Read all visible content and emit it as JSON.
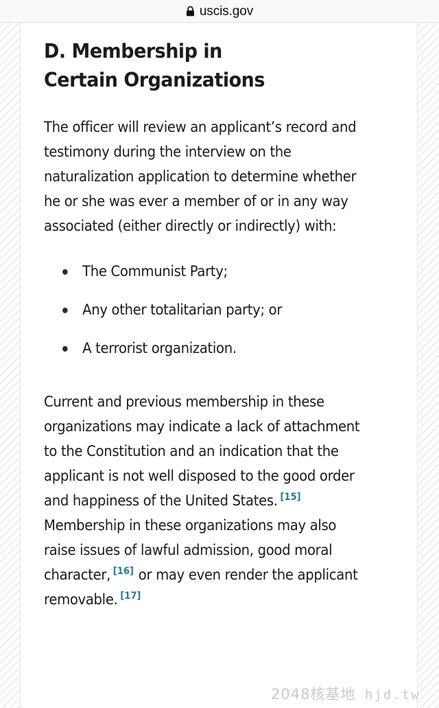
{
  "browser": {
    "lock_icon": "lock-icon",
    "domain": "uscis.gov"
  },
  "article": {
    "heading": "D. Membership in Certain Organizations",
    "intro_paragraph": "The officer will review an applicant’s record and testimony during the interview on the naturalization application to determine whether he or she was ever a member of or in any way associated (either directly or indirectly) with:",
    "list": [
      {
        "text": "The Communist Party;"
      },
      {
        "text": "Any other totalitarian party; or"
      },
      {
        "text": "A terrorist organization."
      }
    ],
    "closing_paragraph": {
      "part1": "Current and previous membership in these organizations may indicate a lack of attachment to the Constitution and an indication that the applicant is not well disposed to the good order and happiness of the United States.",
      "footnote1": "[15]",
      "part2": "Membership in these organizations may also raise issues of lawful admission, good moral character,",
      "footnote2": "[16]",
      "part3": "or may even render the applicant removable.",
      "footnote3": "[17]"
    }
  },
  "watermark": {
    "cjk": "2048核基地",
    "latin": "hjd.tw"
  },
  "colors": {
    "footnote_link": "#2b7a8e",
    "text": "#1b1b1b",
    "browser_bar_bg": "#f9f9f9",
    "gutter_stripe": "#ededed"
  }
}
